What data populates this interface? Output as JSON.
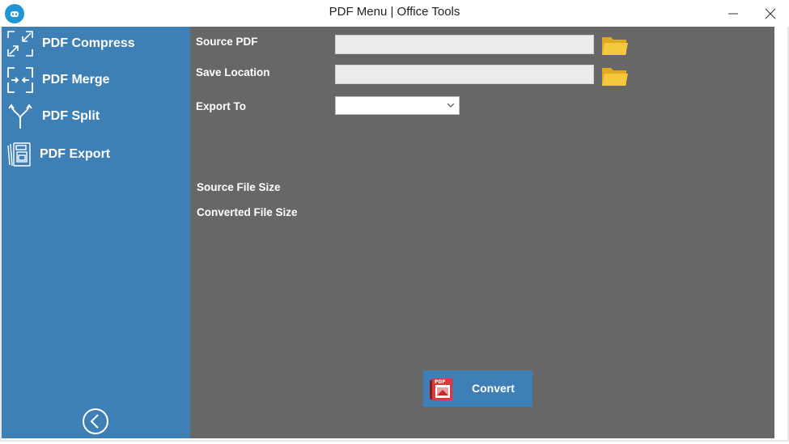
{
  "window": {
    "title": "PDF Menu | Office Tools",
    "minimize_icon": "minimize-icon",
    "close_icon": "close-icon"
  },
  "sidebar": {
    "items": [
      {
        "label": "PDF Compress",
        "icon": "compress-icon"
      },
      {
        "label": "PDF Merge",
        "icon": "merge-icon"
      },
      {
        "label": "PDF Split",
        "icon": "split-icon"
      },
      {
        "label": "PDF Export",
        "icon": "pdf-export-icon"
      }
    ],
    "back_icon": "back-circle-icon"
  },
  "form": {
    "source_pdf_label": "Source PDF",
    "source_pdf_value": "",
    "save_location_label": "Save Location",
    "save_location_value": "",
    "export_to_label": "Export To",
    "export_to_value": "",
    "source_size_label": "Source File Size",
    "converted_size_label": "Converted File Size"
  },
  "actions": {
    "convert_label": "Convert"
  },
  "colors": {
    "sidebar_bg": "#3e7fb6",
    "content_bg": "#676767",
    "button_bg": "#3f7fb8",
    "folder_yellow": "#f2c335"
  }
}
